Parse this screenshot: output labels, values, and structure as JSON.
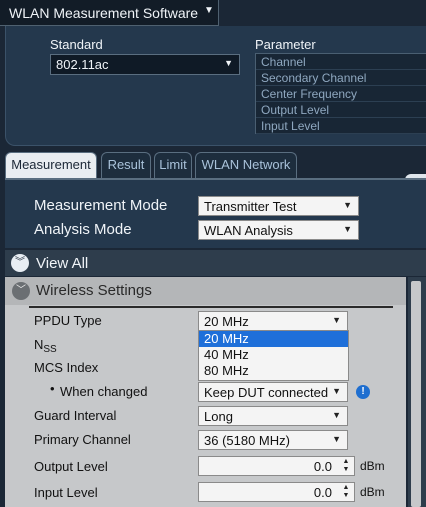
{
  "app": {
    "title": "WLAN Measurement Software"
  },
  "header": {
    "standard_label": "Standard",
    "standard_value": "802.11ac",
    "parameter_label": "Parameter",
    "parameters": [
      "Channel",
      "Secondary Channel",
      "Center Frequency",
      "Output Level",
      "Input Level"
    ]
  },
  "tabs": [
    "Measurement",
    "Result",
    "Limit",
    "WLAN Network"
  ],
  "modes": {
    "measurement_mode_label": "Measurement Mode",
    "measurement_mode_value": "Transmitter Test",
    "analysis_mode_label": "Analysis Mode",
    "analysis_mode_value": "WLAN Analysis"
  },
  "view_all": "View All",
  "wireless_settings": {
    "header": "Wireless Settings",
    "ppdu_type_label": "PPDU Type",
    "ppdu_type_value": "20 MHz",
    "ppdu_options": [
      "20 MHz",
      "40 MHz",
      "80 MHz"
    ],
    "nss_label_main": "N",
    "nss_label_sub": "SS",
    "mcs_index_label": "MCS Index",
    "when_changed_label": "When changed",
    "when_changed_value": "Keep DUT connected",
    "guard_interval_label": "Guard Interval",
    "guard_interval_value": "Long",
    "primary_channel_label": "Primary Channel",
    "primary_channel_value": "36 (5180 MHz)",
    "output_level_label": "Output Level",
    "output_level_value": "0.0",
    "output_level_unit": "dBm",
    "input_level_label": "Input Level",
    "input_level_value": "0.0",
    "input_level_unit": "dBm"
  },
  "colors": {
    "accent": "#1e6fd9",
    "panel_dark": "#24384d",
    "panel_light": "#c6c8ca"
  }
}
